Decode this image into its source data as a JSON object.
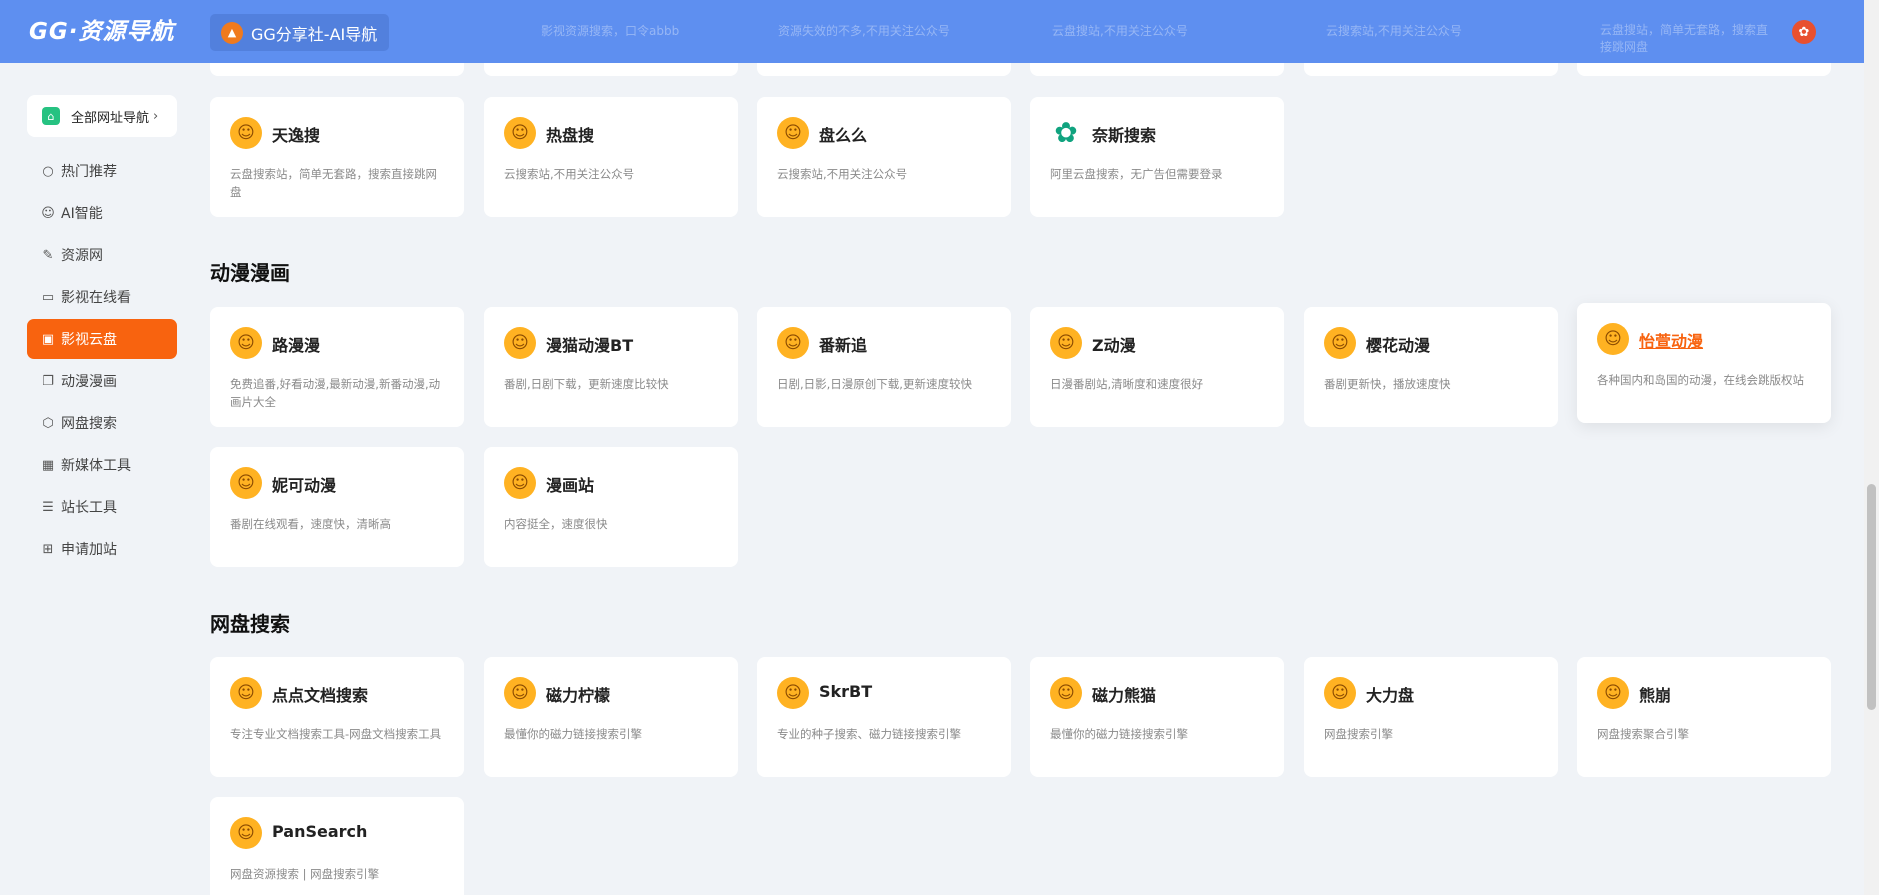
{
  "header": {
    "logo": "GG·资源导航",
    "tab_label": "GG分享社-AI导航",
    "tab_icon": "fire-icon",
    "faded_texts": [
      "影视资源搜索，口令abbb",
      "资源失效的不多,不用关注公众号",
      "云盘搜站,不用关注公众号",
      "云搜索站,不用关注公众号",
      "云盘搜站，简单无套路，搜索直接跳网盘"
    ],
    "theme_icon": "palette-icon"
  },
  "sidebar": {
    "all_nav_label": "全部网址导航",
    "all_nav_arrow": "›",
    "items": [
      {
        "label": "热门推荐",
        "icon": "○"
      },
      {
        "label": "AI智能",
        "icon": "☺"
      },
      {
        "label": "资源网",
        "icon": "✎"
      },
      {
        "label": "影视在线看",
        "icon": "▭"
      },
      {
        "label": "影视云盘",
        "icon": "▣"
      },
      {
        "label": "动漫漫画",
        "icon": "❐"
      },
      {
        "label": "网盘搜索",
        "icon": "⬡"
      },
      {
        "label": "新媒体工具",
        "icon": "▦"
      },
      {
        "label": "站长工具",
        "icon": "☰"
      },
      {
        "label": "申请加站",
        "icon": "⊞"
      }
    ],
    "active_index": 4
  },
  "sections": {
    "cloud": {
      "cards": [
        {
          "title": "天逸搜",
          "desc": "云盘搜索站，简单无套路，搜索直接跳网盘",
          "icon": "hugging-face-icon"
        },
        {
          "title": "热盘搜",
          "desc": "云搜索站,不用关注公众号",
          "icon": "hugging-face-icon"
        },
        {
          "title": "盘么么",
          "desc": "云搜索站,不用关注公众号",
          "icon": "hugging-face-icon"
        },
        {
          "title": "奈斯搜索",
          "desc": "阿里云盘搜索，无广告但需要登录",
          "icon": "openai-icon"
        }
      ]
    },
    "anime": {
      "title": "动漫漫画",
      "cards": [
        {
          "title": "路漫漫",
          "desc": "免费追番,好看动漫,最新动漫,新番动漫,动画片大全"
        },
        {
          "title": "漫猫动漫BT",
          "desc": "番剧,日剧下载，更新速度比较快"
        },
        {
          "title": "番新追",
          "desc": "日剧,日影,日漫原创下载,更新速度较快"
        },
        {
          "title": "Z动漫",
          "desc": "日漫番剧站,清晰度和速度很好"
        },
        {
          "title": "樱花动漫",
          "desc": "番剧更新快，播放速度快"
        },
        {
          "title": "怡萱动漫",
          "desc": "各种国内和岛国的动漫，在线会跳版权站"
        },
        {
          "title": "妮可动漫",
          "desc": "番剧在线观看，速度快，清晰高"
        },
        {
          "title": "漫画站",
          "desc": "内容挺全，速度很快"
        }
      ]
    },
    "netdisk": {
      "title": "网盘搜索",
      "cards": [
        {
          "title": "点点文档搜索",
          "desc": "专注专业文档搜索工具-网盘文档搜索工具"
        },
        {
          "title": "磁力柠檬",
          "desc": "最懂你的磁力链接搜索引擎"
        },
        {
          "title": "SkrBT",
          "desc": "专业的种子搜索、磁力链接搜索引擎"
        },
        {
          "title": "磁力熊猫",
          "desc": "最懂你的磁力链接搜索引擎"
        },
        {
          "title": "大力盘",
          "desc": "网盘搜索引擎"
        },
        {
          "title": "熊崩",
          "desc": "网盘搜索聚合引擎"
        },
        {
          "title": "PanSearch",
          "desc": "网盘资源搜索 | 网盘搜索引擎"
        }
      ]
    }
  }
}
